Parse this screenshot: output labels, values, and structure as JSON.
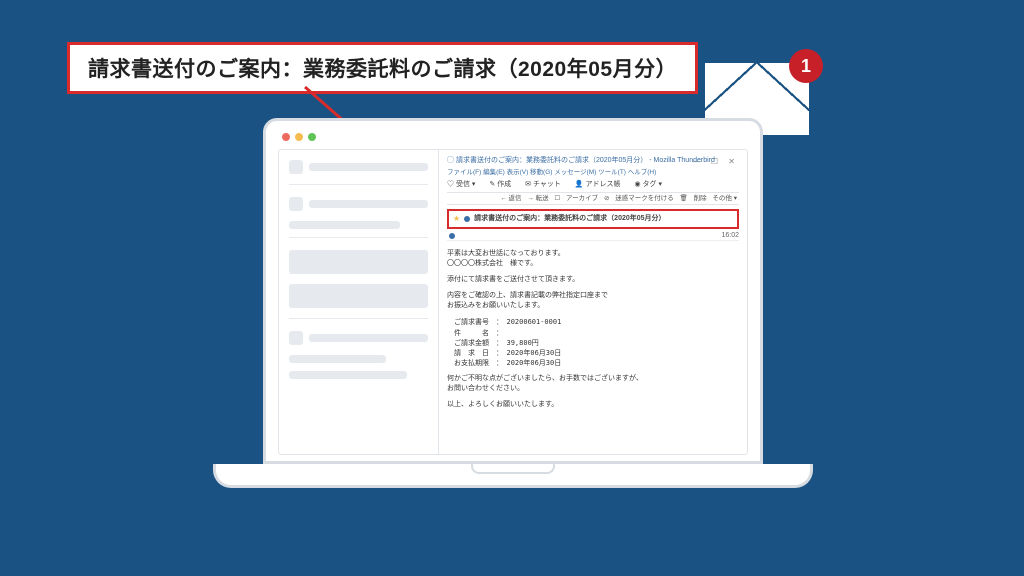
{
  "callout_text": "請求書送付のご案内：業務委託料のご請求（2020年05月分）",
  "badge_count": "1",
  "email": {
    "app_title": "請求書送付のご案内：業務委託料のご請求（2020年05月分） - Mozilla Thunderbird",
    "menubar": "ファイル(F) 編集(E) 表示(V) 移動(G) メッセージ(M) ツール(T) ヘルプ(H)",
    "tb1": {
      "a": "受信 ▾",
      "b": "作成",
      "c": "チャット",
      "d": "アドレス帳",
      "e": "タグ ▾"
    },
    "tb2": {
      "a": "← 返信",
      "b": "→ 転送",
      "c": "アーカイブ",
      "d": "迷惑マークを付ける",
      "e": "削除",
      "f": "その他 ▾"
    },
    "subject_highlight": "請求書送付のご案内：業務委託料のご請求（2020年05月分）",
    "time": "16:02",
    "greeting1": "平素は大変お世話になっております。",
    "greeting2": "〇〇〇〇株式会社　様です。",
    "line1": "添付にて請求書をご送付させて頂きます。",
    "line2": "内容をご確認の上、請求書記載の弊社指定口座まで\nお振込みをお願いいたします。",
    "details": "　ご請求書号　：　20200601-0001\n　件　　　名　：\n　ご請求金額　：　39,800円\n　請　求　日　：　2020年06月30日\n　お支払期限　：　2020年06月30日",
    "line3": "何かご不明な点がございましたら、お手数ではございますが、\nお問い合わせください。",
    "line4": "以上、よろしくお願いいたします。"
  }
}
